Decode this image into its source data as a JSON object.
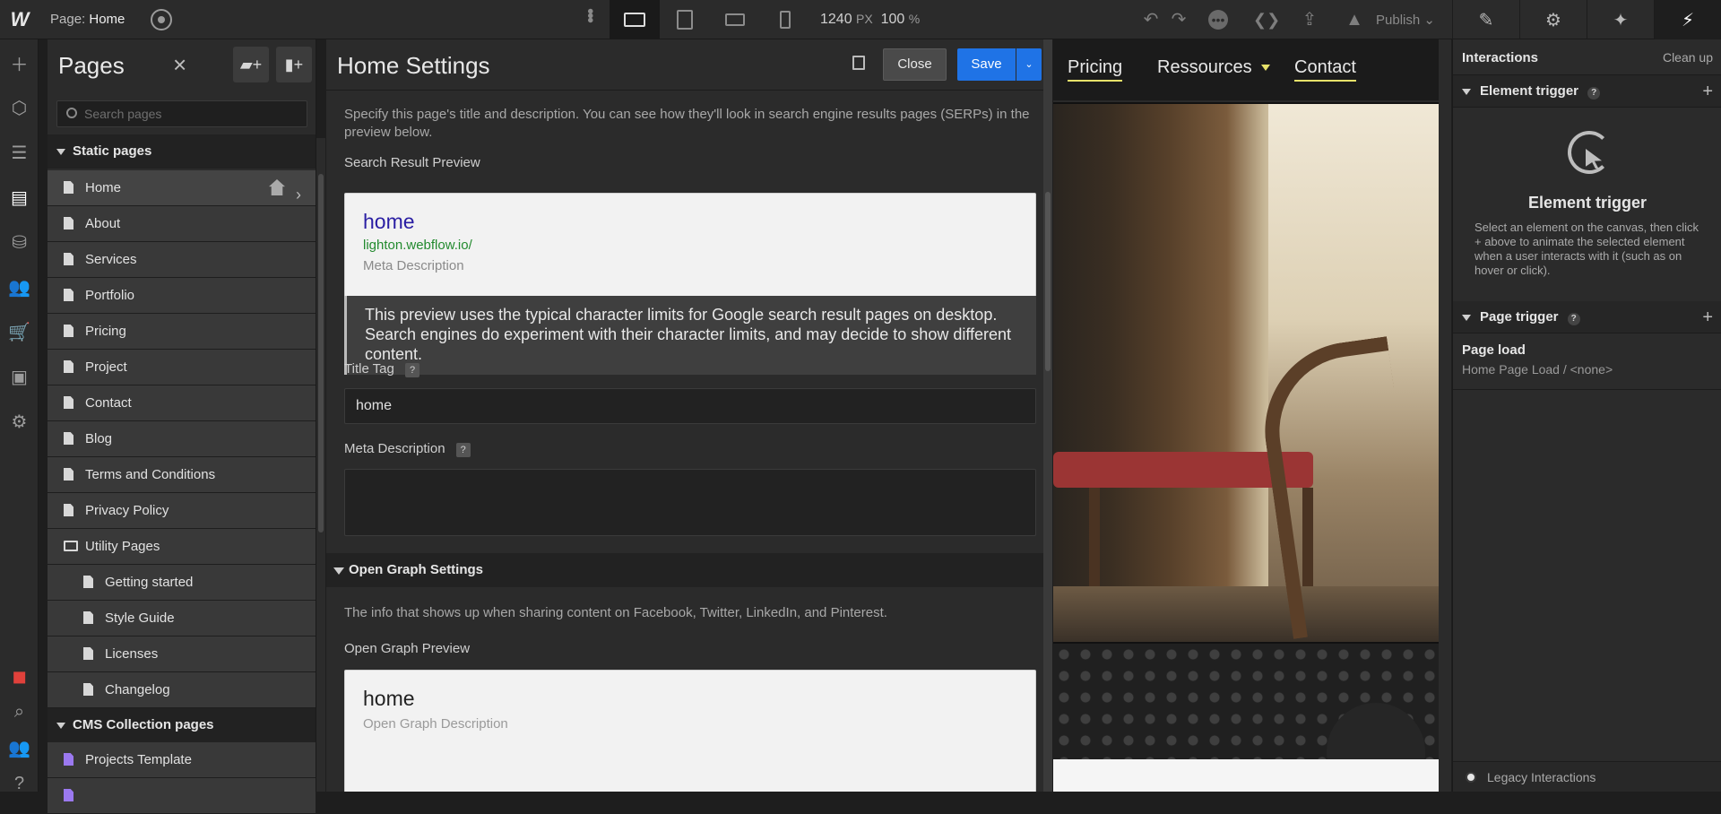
{
  "topbar": {
    "logo": "W",
    "page_label": "Page:",
    "page_name": "Home",
    "width_value": "1240",
    "width_unit": "PX",
    "zoom_value": "100",
    "zoom_unit": "%",
    "publish_label": "Publish"
  },
  "pages_panel": {
    "title": "Pages",
    "search_placeholder": "Search pages",
    "static_header": "Static pages",
    "items": [
      {
        "label": "Home",
        "active": true
      },
      {
        "label": "About"
      },
      {
        "label": "Services"
      },
      {
        "label": "Portfolio"
      },
      {
        "label": "Pricing"
      },
      {
        "label": "Project"
      },
      {
        "label": "Contact"
      },
      {
        "label": "Blog"
      },
      {
        "label": "Terms and Conditions"
      },
      {
        "label": "Privacy Policy"
      }
    ],
    "utility_folder": "Utility Pages",
    "utility_items": [
      "Getting started",
      "Style Guide",
      "Licenses",
      "Changelog"
    ],
    "cms_header": "CMS Collection pages",
    "cms_items": [
      "Projects Template"
    ]
  },
  "settings": {
    "title": "Home Settings",
    "close_label": "Close",
    "save_label": "Save",
    "intro": "Specify this page's title and description. You can see how they'll look in search engine results pages (SERPs) in the preview below.",
    "search_preview_label": "Search Result Preview",
    "serp": {
      "title": "home",
      "url": "lighton.webflow.io/",
      "description": "Meta Description"
    },
    "note": "This preview uses the typical character limits for Google search result pages on desktop. Search engines do experiment with their character limits, and may decide to show different content.",
    "title_tag_label": "Title Tag",
    "title_tag_value": "home",
    "meta_desc_label": "Meta Description",
    "meta_desc_value": "",
    "help_glyph": "?",
    "og_header": "Open Graph Settings",
    "og_intro": "The info that shows up when sharing content on Facebook, Twitter, LinkedIn, and Pinterest.",
    "og_preview_label": "Open Graph Preview",
    "og": {
      "title": "home",
      "description": "Open Graph Description"
    }
  },
  "canvas": {
    "nav": [
      "Pricing",
      "Ressources",
      "Contact"
    ],
    "accent": "#e7e26a"
  },
  "interactions": {
    "title": "Interactions",
    "clean_up": "Clean up",
    "element_trigger_header": "Element trigger",
    "element_trigger_title": "Element trigger",
    "element_trigger_desc": "Select an element on the canvas, then click + above to animate the selected element when a user interacts with it (such as on hover or click).",
    "page_trigger_header": "Page trigger",
    "page_load_label": "Page load",
    "page_load_value": "Home Page Load / <none>",
    "legacy_label": "Legacy Interactions"
  },
  "colors": {
    "primary": "#1f73e6",
    "panel": "#2b2b2b",
    "serp_title": "#2a1ea3",
    "serp_url": "#228a2e"
  }
}
